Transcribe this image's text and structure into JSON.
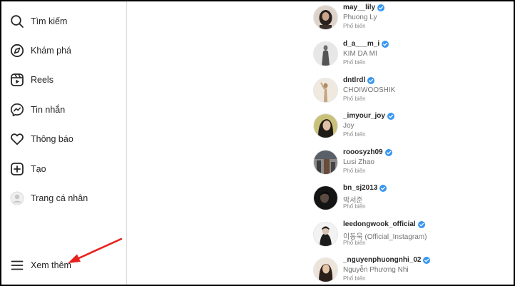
{
  "sidebar": {
    "items": [
      {
        "label": "Tìm kiếm",
        "icon": "search-icon"
      },
      {
        "label": "Khám phá",
        "icon": "compass-icon"
      },
      {
        "label": "Reels",
        "icon": "reels-icon"
      },
      {
        "label": "Tin nhắn",
        "icon": "messenger-icon"
      },
      {
        "label": "Thông báo",
        "icon": "heart-icon"
      },
      {
        "label": "Tạo",
        "icon": "create-icon"
      },
      {
        "label": "Trang cá nhân",
        "icon": "avatar-icon"
      }
    ],
    "more": {
      "label": "Xem thêm",
      "icon": "menu-icon"
    }
  },
  "accounts": [
    {
      "username": "may__lily",
      "fullname": "Phuong Ly",
      "tag": "Phổ biến"
    },
    {
      "username": "d_a___m_i",
      "fullname": "KIM DA MI",
      "tag": "Phổ biến"
    },
    {
      "username": "dntlrdl",
      "fullname": "CHOIWOOSHIK",
      "tag": "Phổ biến"
    },
    {
      "username": "_imyour_joy",
      "fullname": "Joy",
      "tag": "Phổ biến"
    },
    {
      "username": "rooosyzh09",
      "fullname": "Lusi Zhao",
      "tag": "Phổ biến"
    },
    {
      "username": "bn_sj2013",
      "fullname": "박서준",
      "tag": "Phổ biến"
    },
    {
      "username": "leedongwook_official",
      "fullname": "이동욱 (Official_Instagram)",
      "tag": "Phổ biến"
    },
    {
      "username": "_nguyenphuongnhi_02",
      "fullname": "Nguyễn Phương Nhi",
      "tag": "Phổ biến"
    }
  ],
  "colors": {
    "verified": "#3897f0",
    "annotation_arrow": "#e8201e"
  }
}
